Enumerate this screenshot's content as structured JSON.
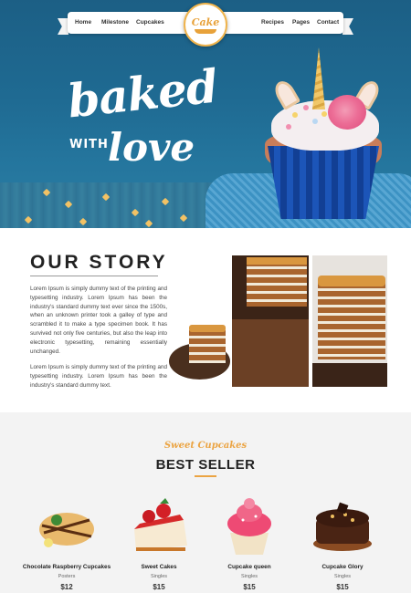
{
  "nav": {
    "left_links": [
      "Home",
      "Milestone",
      "Cupcakes"
    ],
    "right_links": [
      "Recipes",
      "Pages",
      "Contact"
    ],
    "logo_text": "Cake"
  },
  "hero": {
    "line1": "baked",
    "line2": "WITH",
    "line3": "love"
  },
  "story": {
    "title": "OUR STORY",
    "paragraph1": "Lorem Ipsum is simply dummy text of the printing and typesetting industry. Lorem Ipsum has been the industry's standard dummy text ever since the 1500s, when an unknown printer took a galley of type and scrambled it to make a type specimen book. It has survived not only five centuries, but also the leap into electronic typesetting, remaining essentially unchanged.",
    "paragraph2": "Lorem Ipsum is simply dummy text of the printing and typesetting industry. Lorem Ipsum has been the industry's standard dummy text."
  },
  "best_seller": {
    "subtitle": "Sweet Cupcakes",
    "title": "BEST SELLER",
    "products": [
      {
        "name": "Chocolate Raspberry Cupcakes",
        "category": "Posters",
        "price": "$12",
        "icon": "crepe-image"
      },
      {
        "name": "Sweet Cakes",
        "category": "Singles",
        "price": "$15",
        "icon": "strawberry-cheesecake-image"
      },
      {
        "name": "Cupcake queen",
        "category": "Singles",
        "price": "$15",
        "icon": "pink-cupcake-image"
      },
      {
        "name": "Cupcake Glory",
        "category": "Singles",
        "price": "$15",
        "icon": "chocolate-cake-image"
      }
    ]
  },
  "colors": {
    "accent": "#eba443",
    "hero_blue": "#1f6b93",
    "text_dark": "#222222"
  }
}
